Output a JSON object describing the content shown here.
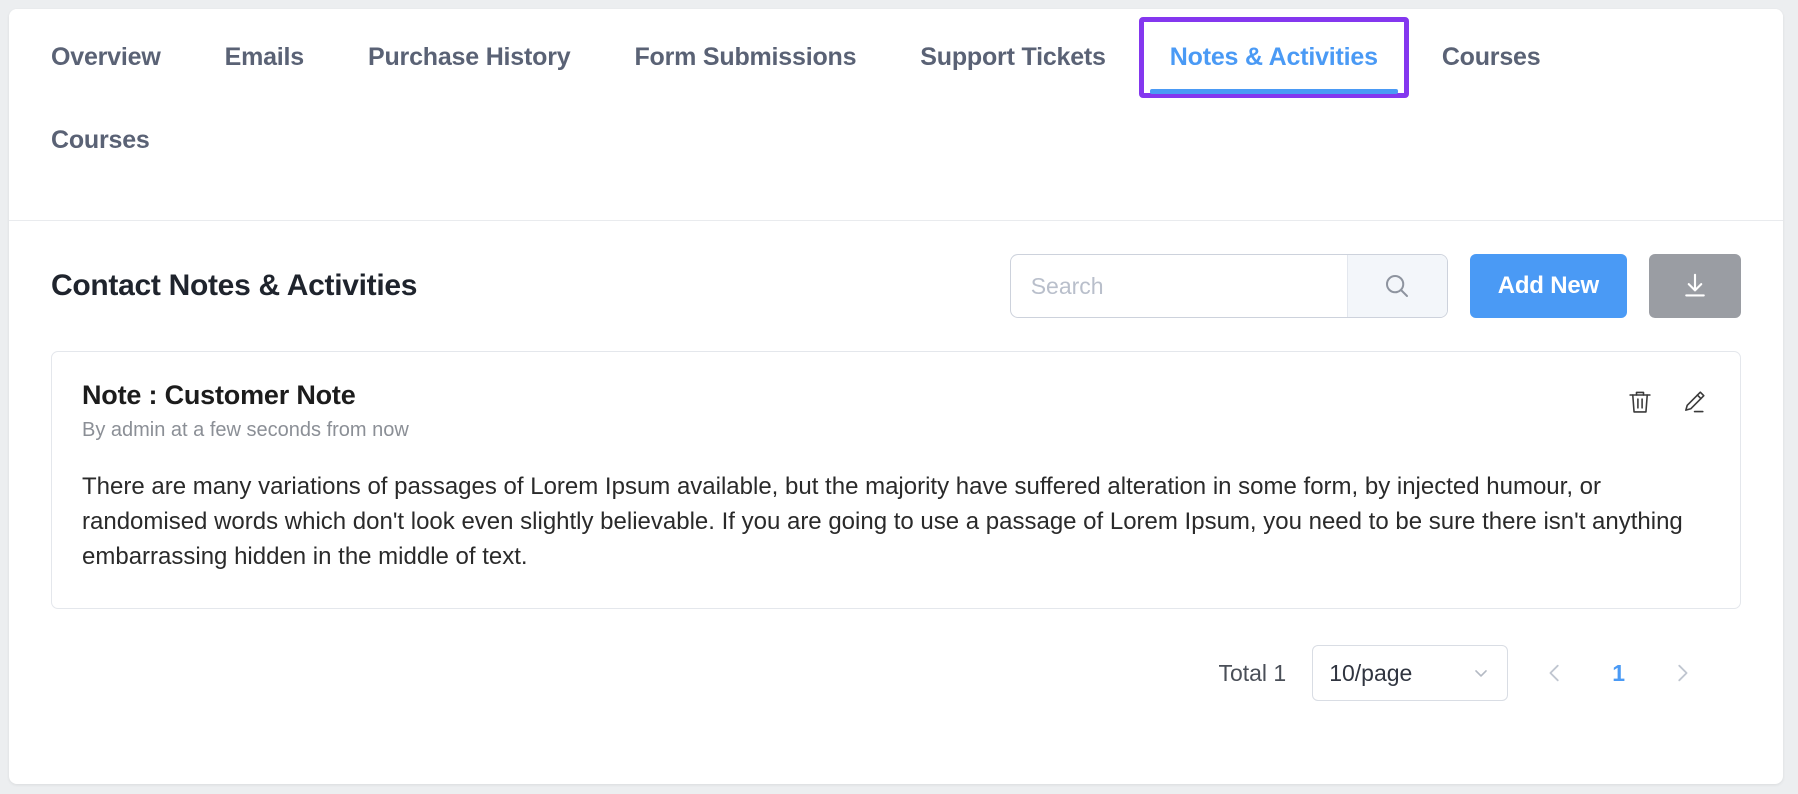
{
  "tabs": {
    "row1": [
      {
        "label": "Overview",
        "active": false
      },
      {
        "label": "Emails",
        "active": false
      },
      {
        "label": "Purchase History",
        "active": false
      },
      {
        "label": "Form Submissions",
        "active": false
      },
      {
        "label": "Support Tickets",
        "active": false
      },
      {
        "label": "Notes & Activities",
        "active": true,
        "highlighted": true
      },
      {
        "label": "Courses",
        "active": false
      }
    ],
    "row2": [
      {
        "label": "Courses",
        "active": false
      }
    ],
    "active_color": "#4a9af5",
    "inactive_color": "#5a6275",
    "highlight_color": "#8437ef"
  },
  "header": {
    "title": "Contact Notes & Activities",
    "search": {
      "placeholder": "Search",
      "value": "",
      "icon": "search-icon"
    },
    "add_button": {
      "label": "Add New",
      "color": "#4a9af5"
    },
    "download_button": {
      "icon": "download-icon",
      "color": "#9a9da3"
    }
  },
  "note": {
    "title": "Note : Customer Note",
    "meta": "By admin at a few seconds from now",
    "body": "There are many variations of passages of Lorem Ipsum available, but the majority have suffered alteration in some form, by injected humour, or randomised words which don't look even slightly believable. If you are going to use a passage of Lorem Ipsum, you need to be sure there isn't anything embarrassing hidden in the middle of text.",
    "actions": {
      "delete_icon": "trash-icon",
      "edit_icon": "pencil-icon"
    }
  },
  "pagination": {
    "total_label": "Total 1",
    "page_size": "10/page",
    "current_page": "1",
    "prev_icon": "chevron-left-icon",
    "next_icon": "chevron-right-icon",
    "page_color": "#4a9af5"
  }
}
